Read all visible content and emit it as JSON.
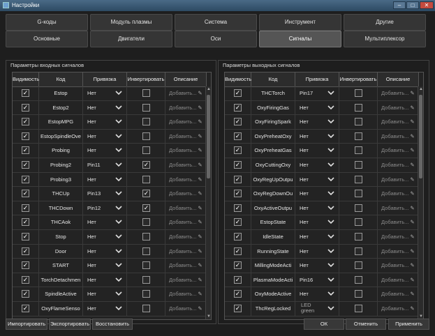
{
  "window": {
    "title": "Настройки"
  },
  "tabs_row1": [
    "G-коды",
    "Модуль плазмы",
    "Система",
    "Инструмент",
    "Другие"
  ],
  "tabs_row2": [
    "Основные",
    "Двигатели",
    "Оси",
    "Сигналы",
    "Мультиплексор"
  ],
  "active_tab": "Сигналы",
  "input_group": {
    "title": "Параметры входных сигналов",
    "headers": [
      "Видимость",
      "Код",
      "Привязка",
      "Инвертировать",
      "Описание"
    ],
    "rows": [
      {
        "visible": true,
        "code": "Estop",
        "binding": "Нет",
        "invert": false,
        "desc": "Добавить..."
      },
      {
        "visible": true,
        "code": "Estop2",
        "binding": "Нет",
        "invert": false,
        "desc": "Добавить..."
      },
      {
        "visible": true,
        "code": "EstopMPG",
        "binding": "Нет",
        "invert": false,
        "desc": "Добавить..."
      },
      {
        "visible": true,
        "code": "EstopSpindleOve",
        "binding": "Нет",
        "invert": false,
        "desc": "Добавить..."
      },
      {
        "visible": true,
        "code": "Probing",
        "binding": "Нет",
        "invert": false,
        "desc": "Добавить..."
      },
      {
        "visible": true,
        "code": "Probing2",
        "binding": "Pin11",
        "invert": true,
        "desc": "Добавить..."
      },
      {
        "visible": true,
        "code": "Probing3",
        "binding": "Нет",
        "invert": false,
        "desc": "Добавить..."
      },
      {
        "visible": true,
        "code": "THCUp",
        "binding": "Pin13",
        "invert": true,
        "desc": "Добавить..."
      },
      {
        "visible": true,
        "code": "THCDown",
        "binding": "Pin12",
        "invert": true,
        "desc": "Добавить..."
      },
      {
        "visible": true,
        "code": "THCAok",
        "binding": "Нет",
        "invert": false,
        "desc": "Добавить..."
      },
      {
        "visible": true,
        "code": "Stop",
        "binding": "Нет",
        "invert": false,
        "desc": "Добавить..."
      },
      {
        "visible": true,
        "code": "Door",
        "binding": "Нет",
        "invert": false,
        "desc": "Добавить..."
      },
      {
        "visible": true,
        "code": "START",
        "binding": "Нет",
        "invert": false,
        "desc": "Добавить..."
      },
      {
        "visible": true,
        "code": "TorchDetachmen",
        "binding": "Нет",
        "invert": false,
        "desc": "Добавить..."
      },
      {
        "visible": true,
        "code": "SpindleActive",
        "binding": "Нет",
        "invert": false,
        "desc": "Добавить..."
      },
      {
        "visible": true,
        "code": "OxyFlameSenso",
        "binding": "Нет",
        "invert": false,
        "desc": "Добавить..."
      }
    ]
  },
  "output_group": {
    "title": "Параметры выходных сигналов",
    "headers": [
      "Видимость",
      "Код",
      "Привязка",
      "Инвертировать",
      "Описание"
    ],
    "rows": [
      {
        "visible": true,
        "code": "THCTorch",
        "binding": "Pin17",
        "invert": false,
        "desc": "Добавить..."
      },
      {
        "visible": true,
        "code": "OxyFiringGas",
        "binding": "Нет",
        "invert": false,
        "desc": "Добавить..."
      },
      {
        "visible": true,
        "code": "OxyFiringSpark",
        "binding": "Нет",
        "invert": false,
        "desc": "Добавить..."
      },
      {
        "visible": true,
        "code": "OxyPreheatOxy",
        "binding": "Нет",
        "invert": false,
        "desc": "Добавить..."
      },
      {
        "visible": true,
        "code": "OxyPreheatGas",
        "binding": "Нет",
        "invert": false,
        "desc": "Добавить..."
      },
      {
        "visible": true,
        "code": "OxyCuttingOxy",
        "binding": "Нет",
        "invert": false,
        "desc": "Добавить..."
      },
      {
        "visible": true,
        "code": "OxyRegUpOutpu",
        "binding": "Нет",
        "invert": false,
        "desc": "Добавить..."
      },
      {
        "visible": true,
        "code": "OxyRegDownOu",
        "binding": "Нет",
        "invert": false,
        "desc": "Добавить..."
      },
      {
        "visible": true,
        "code": "OxyActiveOutpu",
        "binding": "Нет",
        "invert": false,
        "desc": "Добавить..."
      },
      {
        "visible": true,
        "code": "EstopState",
        "binding": "Нет",
        "invert": false,
        "desc": "Добавить..."
      },
      {
        "visible": true,
        "code": "IdleState",
        "binding": "Нет",
        "invert": false,
        "desc": "Добавить..."
      },
      {
        "visible": true,
        "code": "RunningState",
        "binding": "Нет",
        "invert": false,
        "desc": "Добавить..."
      },
      {
        "visible": true,
        "code": "MillingModeActi",
        "binding": "Нет",
        "invert": false,
        "desc": "Добавить..."
      },
      {
        "visible": true,
        "code": "PlasmaModeActi",
        "binding": "Pin16",
        "invert": false,
        "desc": "Добавить..."
      },
      {
        "visible": true,
        "code": "OxyModeActive",
        "binding": "Нет",
        "invert": false,
        "desc": "Добавить..."
      },
      {
        "visible": true,
        "code": "ThcRegLocked",
        "binding": "LED",
        "binding2": "green",
        "invert": false,
        "desc": "Добавить..."
      }
    ]
  },
  "buttons": {
    "import": "Импортировать",
    "export": "Экспортировать",
    "restore": "Восстановить",
    "ok": "ОК",
    "cancel": "Отменить",
    "apply": "Применить"
  },
  "icons": {
    "check": "✓",
    "pen": "✎",
    "chevron": "chevron-down-icon"
  }
}
